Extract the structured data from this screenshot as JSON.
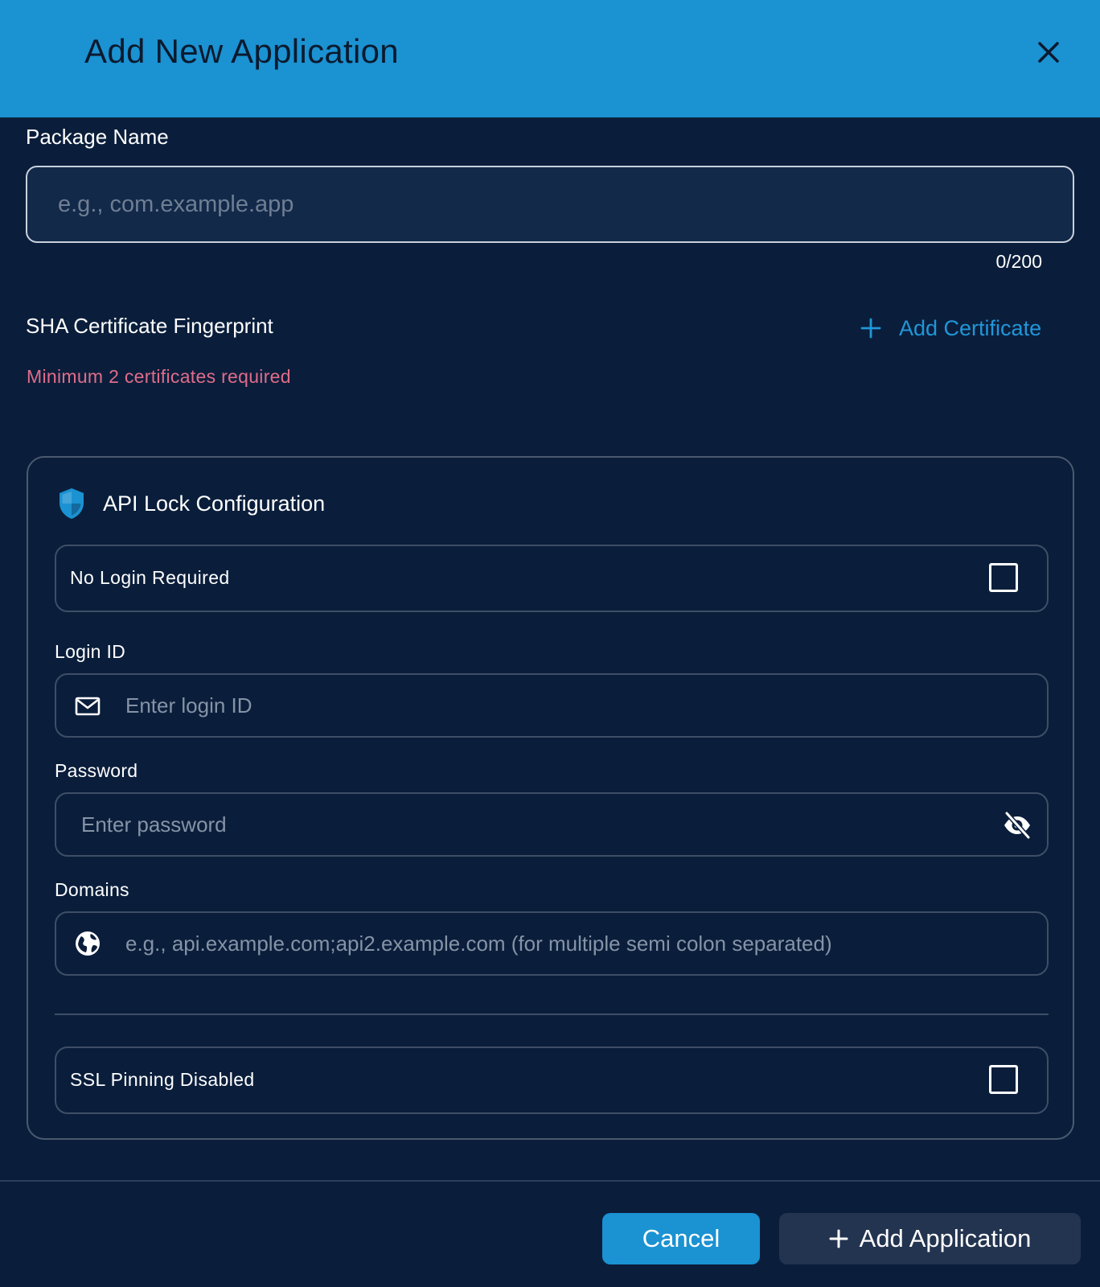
{
  "dialog": {
    "title": "Add New Application",
    "accent_color": "#1b92d2"
  },
  "package": {
    "label": "Package Name",
    "placeholder": "e.g., com.example.app",
    "counter": "0/200"
  },
  "certificates": {
    "label": "SHA Certificate Fingerprint",
    "add_label": "Add Certificate",
    "error": "Minimum 2 certificates required",
    "error_color": "#e06c8a"
  },
  "api_lock": {
    "title": "API Lock Configuration",
    "no_login": {
      "label": "No Login Required",
      "checked": false
    },
    "login_id": {
      "label": "Login ID",
      "placeholder": "Enter login ID"
    },
    "password": {
      "label": "Password",
      "placeholder": "Enter password"
    },
    "domains": {
      "label": "Domains",
      "placeholder": "e.g., api.example.com;api2.example.com (for multiple semi colon separated)"
    },
    "ssl": {
      "label": "SSL Pinning Disabled",
      "checked": false
    }
  },
  "footer": {
    "cancel_label": "Cancel",
    "add_label": "Add Application"
  }
}
